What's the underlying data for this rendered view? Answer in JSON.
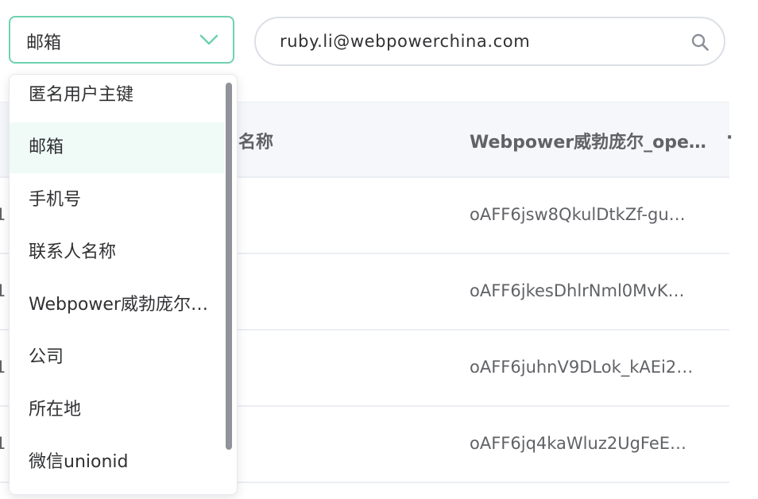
{
  "filter": {
    "selected": "邮箱",
    "options": [
      "匿名用户主键",
      "邮箱",
      "手机号",
      "联系人名称",
      "Webpower威勃庞尔_openid",
      "公司",
      "所在地",
      "微信unionid"
    ],
    "accent_color": "#6fd1b1"
  },
  "search": {
    "value": "ruby.li@webpowerchina.com"
  },
  "table": {
    "headers": [
      "名称",
      "Webpower威勃庞尔_openid",
      "·"
    ],
    "rows": [
      {
        "c0": "1",
        "openid": "oAFF6jsw8QkulDtkZf-gu…"
      },
      {
        "c0": "1",
        "openid": "oAFF6jkesDhlrNml0MvK…"
      },
      {
        "c0": "1",
        "openid": "oAFF6juhnV9DLok_kAEi2…"
      },
      {
        "c0": "1",
        "openid": "oAFF6jq4kaWluz2UgFeE…"
      }
    ]
  },
  "icons": {
    "select_arrow": "chevron-down-icon",
    "search": "search-icon"
  }
}
